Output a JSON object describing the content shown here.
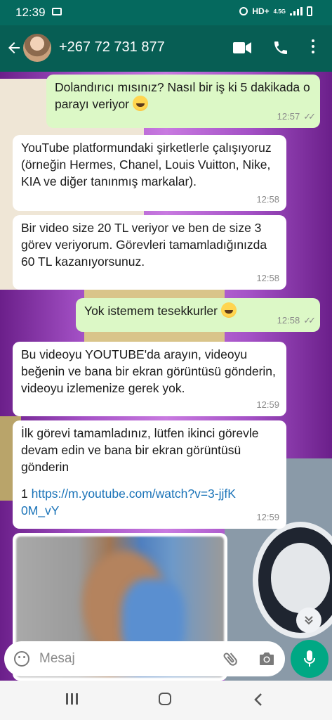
{
  "status_bar": {
    "time": "12:39",
    "network": "HD+",
    "network_sub": "4.5G"
  },
  "header": {
    "contact_name": "+267 72 731 877"
  },
  "messages": [
    {
      "direction": "out",
      "text": "Dolandırıcı mısınız? Nasıl bir iş ki 5 dakikada o parayı veriyor",
      "emoji": "grinning-face",
      "time": "12:57",
      "status": "read"
    },
    {
      "direction": "in",
      "text": "YouTube platformundaki şirketlerle çalışıyoruz (örneğin Hermes, Chanel, Louis Vuitton, Nike, KIA ve diğer tanınmış markalar).",
      "time": "12:58"
    },
    {
      "direction": "in",
      "text": "Bir video size 20 TL veriyor ve ben de size 3 görev veriyorum. Görevleri tamamladığınızda 60 TL kazanıyorsunuz.",
      "time": "12:58"
    },
    {
      "direction": "out",
      "text": "Yok istemem tesekkurler",
      "emoji": "grinning-face",
      "time": "12:58",
      "status": "read"
    },
    {
      "direction": "in",
      "text": "Bu videoyu YOUTUBE'da arayın, videoyu beğenin ve bana bir ekran görüntüsü gönderin, videoyu izlemenize gerek yok.",
      "time": "12:59"
    },
    {
      "direction": "in",
      "text": "İlk görevi tamamladınız, lütfen ikinci görevle devam edin ve bana bir ekran görüntüsü gönderin",
      "prefix": "1",
      "link": "https://m.youtube.com/watch?v=3-jjfK0M_vY",
      "time": "12:59"
    }
  ],
  "composer": {
    "placeholder": "Mesaj"
  },
  "icons": {
    "back": "arrow-left-icon",
    "video": "video-call-icon",
    "call": "phone-icon",
    "more": "more-vert-icon",
    "emoji": "emoji-icon",
    "attach": "paperclip-icon",
    "camera": "camera-icon",
    "mic": "mic-icon",
    "scroll": "chevron-double-down-icon"
  },
  "colors": {
    "header": "#075e54",
    "out_bubble": "#dcf8c6",
    "in_bubble": "#ffffff",
    "mic": "#00a884",
    "link": "#1a73b8"
  }
}
